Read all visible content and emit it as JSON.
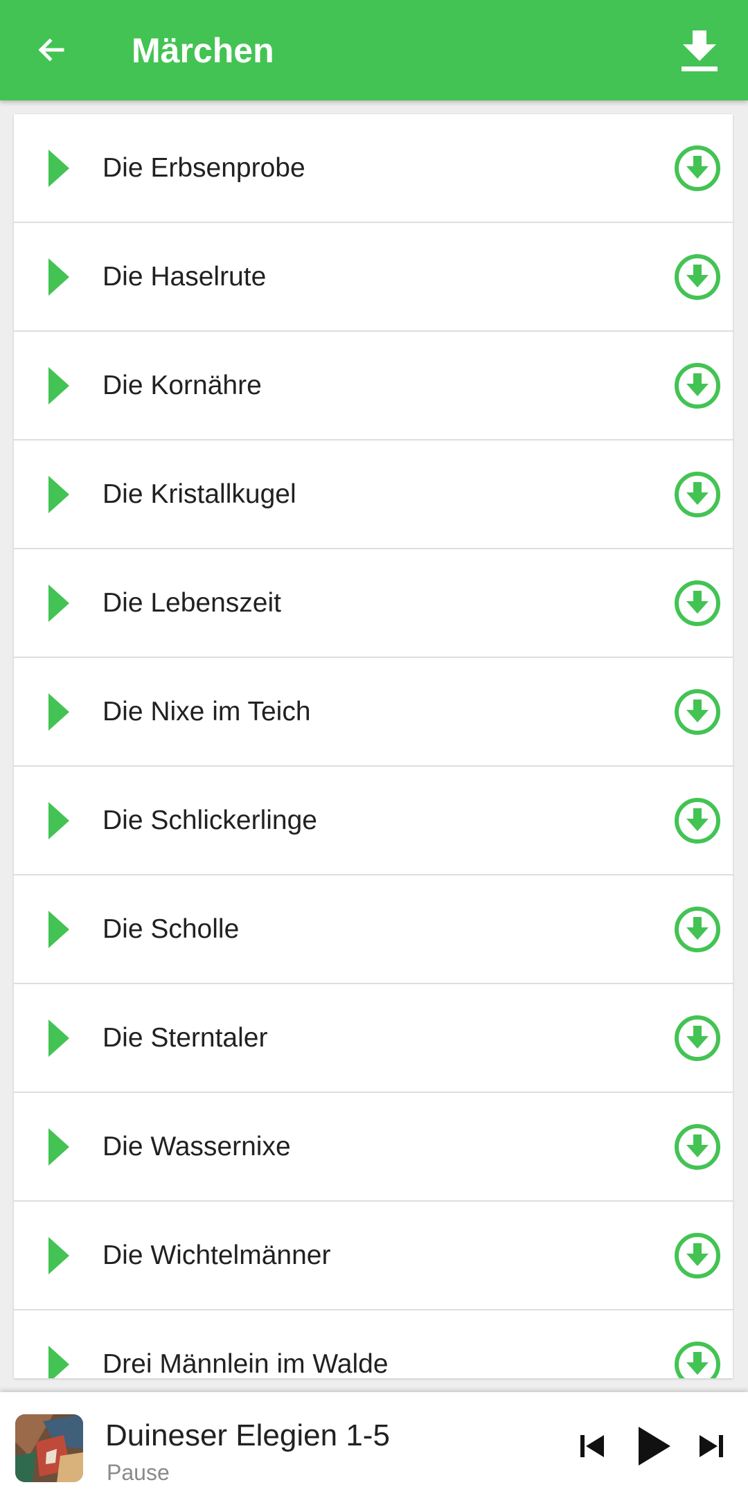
{
  "appbar": {
    "title": "Märchen",
    "back_icon": "arrow-left-icon",
    "download_all_icon": "download-icon",
    "color": "#43c353"
  },
  "stories": [
    {
      "title": "Die Erbsenprobe"
    },
    {
      "title": "Die Haselrute"
    },
    {
      "title": "Die Kornähre"
    },
    {
      "title": "Die Kristallkugel"
    },
    {
      "title": "Die Lebenszeit"
    },
    {
      "title": "Die Nixe im Teich"
    },
    {
      "title": "Die Schlickerlinge"
    },
    {
      "title": "Die Scholle"
    },
    {
      "title": "Die Sterntaler"
    },
    {
      "title": "Die Wassernixe"
    },
    {
      "title": "Die Wichtelmänner"
    },
    {
      "title": "Drei Männlein im Walde"
    }
  ],
  "row_icons": {
    "play": "play-triangle-icon",
    "download": "download-circle-icon"
  },
  "player": {
    "title": "Duineser Elegien 1-5",
    "status": "Pause",
    "controls": [
      "skip-previous-icon",
      "play-icon",
      "skip-next-icon"
    ]
  }
}
